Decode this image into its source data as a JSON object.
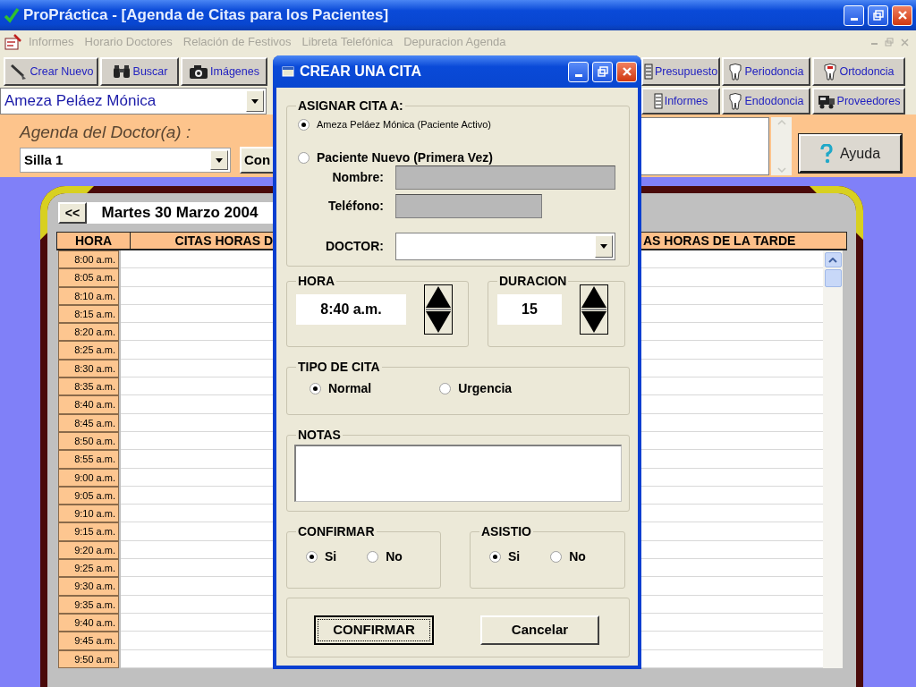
{
  "window": {
    "title": "ProPráctica - [Agenda de Citas para los Pacientes]"
  },
  "menu": [
    {
      "label": "Informes",
      "disabled": true
    },
    {
      "label": "Horario Doctores",
      "disabled": true
    },
    {
      "label": "Relación de Festivos",
      "disabled": true
    },
    {
      "label": "Libreta Telefónica",
      "disabled": true
    },
    {
      "label": "Depuracion Agenda",
      "disabled": true
    }
  ],
  "toolbar": {
    "row_1_left": [
      "Crear Nuevo",
      "Buscar",
      "Imágenes"
    ],
    "row_1_right": [
      "Presupuesto",
      "Periodoncia",
      "Ortodoncia"
    ],
    "row_2_right": [
      "Informes",
      "Endodoncia",
      "Proveedores"
    ]
  },
  "patient_select": {
    "value": "Ameza Peláez Mónica"
  },
  "doctor_panel": {
    "label": "Agenda del Doctor(a) :",
    "chair_select": {
      "value": "Silla 1"
    },
    "button": "Con",
    "help_button": "Ayuda"
  },
  "agenda": {
    "prev_button": "<<",
    "date": "Martes 30 Marzo 2004",
    "columns": [
      "HORA",
      "CITAS HORAS D",
      "AS HORAS DE LA TARDE"
    ],
    "times": [
      "8:00 a.m.",
      "8:05 a.m.",
      "8:10 a.m.",
      "8:15 a.m.",
      "8:20 a.m.",
      "8:25 a.m.",
      "8:30 a.m.",
      "8:35 a.m.",
      "8:40 a.m.",
      "8:45 a.m.",
      "8:50 a.m.",
      "8:55 a.m.",
      "9:00 a.m.",
      "9:05 a.m.",
      "9:10 a.m.",
      "9:15 a.m.",
      "9:20 a.m.",
      "9:25 a.m.",
      "9:30 a.m.",
      "9:35 a.m.",
      "9:40 a.m.",
      "9:45 a.m.",
      "9:50 a.m."
    ]
  },
  "dialog": {
    "title": "CREAR UNA CITA",
    "assign": {
      "legend": "ASIGNAR CITA A:",
      "options": [
        {
          "label": "Ameza Peláez Mónica (Paciente Activo)",
          "selected": true
        },
        {
          "label": "Paciente Nuevo (Primera Vez)",
          "selected": false
        }
      ],
      "fields": [
        {
          "label": "Nombre:",
          "disabled": true
        },
        {
          "label": "Teléfono:",
          "disabled": true
        }
      ],
      "doctor": {
        "label": "DOCTOR:"
      }
    },
    "hora": {
      "legend": "HORA",
      "value": "8:40 a.m."
    },
    "duracion": {
      "legend": "DURACION",
      "value": "15"
    },
    "tipo": {
      "legend": "TIPO DE CITA",
      "options": [
        {
          "label": "Normal",
          "selected": true
        },
        {
          "label": "Urgencia",
          "selected": false
        }
      ]
    },
    "notas": {
      "legend": "NOTAS"
    },
    "confirmar": {
      "legend": "CONFIRMAR",
      "options": [
        {
          "label": "Si",
          "selected": true
        },
        {
          "label": "No",
          "selected": false
        }
      ]
    },
    "asistio": {
      "legend": "ASISTIO",
      "options": [
        {
          "label": "Si",
          "selected": true
        },
        {
          "label": "No",
          "selected": false
        }
      ]
    },
    "buttons": [
      {
        "label": "CONFIRMAR",
        "focused": true
      },
      {
        "label": "Cancelar",
        "focused": false
      }
    ]
  }
}
